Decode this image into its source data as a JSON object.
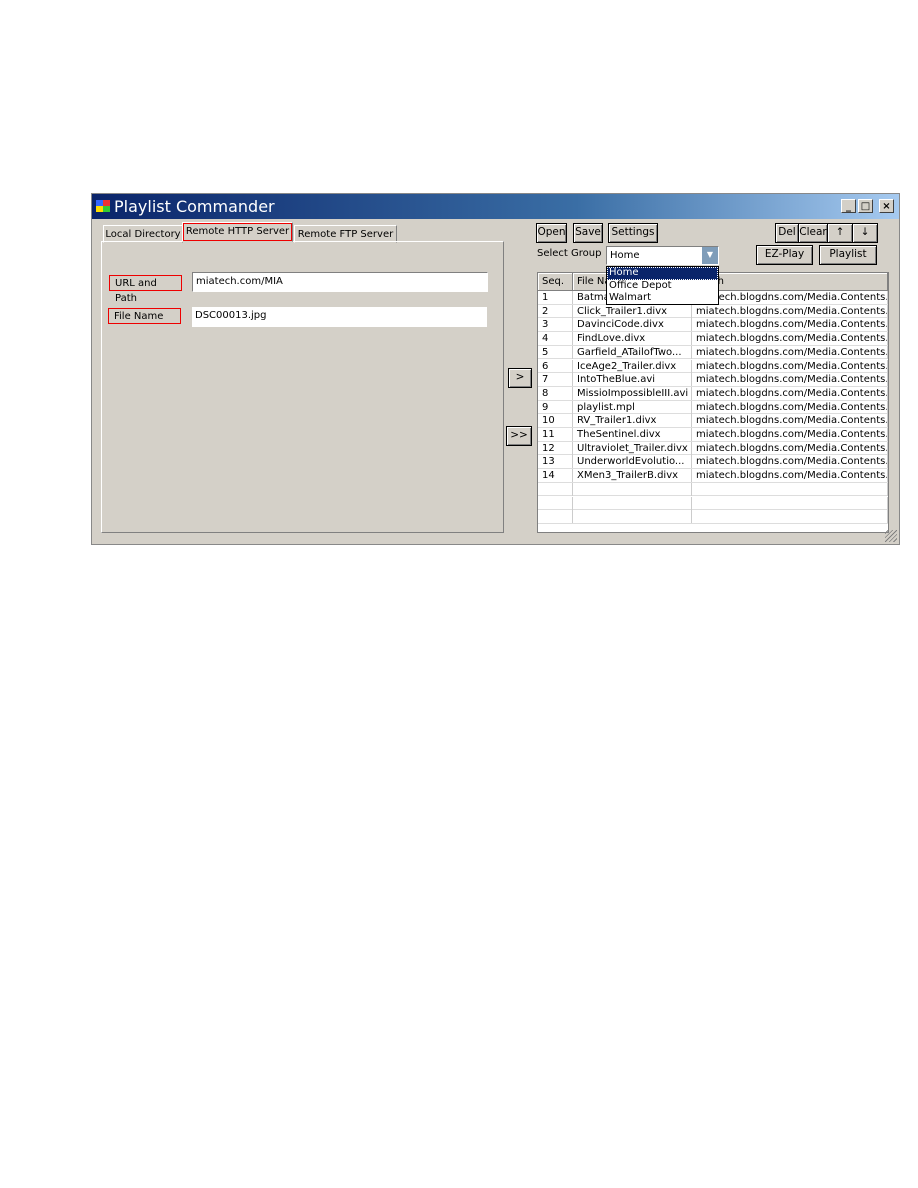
{
  "window": {
    "title": "Playlist Commander",
    "minimize": "_",
    "maximize": "□",
    "close": "×"
  },
  "tabs": [
    {
      "label": "Local Directory"
    },
    {
      "label": "Remote HTTP Server",
      "active": true
    },
    {
      "label": "Remote FTP Server"
    }
  ],
  "form": {
    "url_label": "URL and Path",
    "url_value": "miatech.com/MIA",
    "file_label": "File Name",
    "file_value": "DSC00013.jpg"
  },
  "transfer": {
    "add_one": ">",
    "add_all": ">>"
  },
  "toolbar": {
    "open": "Open",
    "save": "Save",
    "settings": "Settings",
    "del": "Del",
    "clear": "Clear",
    "up": "↑",
    "down": "↓",
    "ez_play": "EZ-Play",
    "playlist": "Playlist"
  },
  "group": {
    "label": "Select Group",
    "selected": "Home",
    "options": [
      "Home",
      "Office Depot",
      "Walmart"
    ]
  },
  "table": {
    "columns": [
      "Seq.",
      "File Name",
      "Path"
    ],
    "rows": [
      [
        "1",
        "Batma",
        "miatech.blogdns.com/Media.Contents..."
      ],
      [
        "2",
        "Click_Trailer1.divx",
        "miatech.blogdns.com/Media.Contents..."
      ],
      [
        "3",
        "DavinciCode.divx",
        "miatech.blogdns.com/Media.Contents..."
      ],
      [
        "4",
        "FindLove.divx",
        "miatech.blogdns.com/Media.Contents..."
      ],
      [
        "5",
        "Garfield_ATailofTwo...",
        "miatech.blogdns.com/Media.Contents..."
      ],
      [
        "6",
        "IceAge2_Trailer.divx",
        "miatech.blogdns.com/Media.Contents..."
      ],
      [
        "7",
        "IntoTheBlue.avi",
        "miatech.blogdns.com/Media.Contents..."
      ],
      [
        "8",
        "MissioImpossibleIII.avi",
        "miatech.blogdns.com/Media.Contents..."
      ],
      [
        "9",
        "playlist.mpl",
        "miatech.blogdns.com/Media.Contents..."
      ],
      [
        "10",
        "RV_Trailer1.divx",
        "miatech.blogdns.com/Media.Contents..."
      ],
      [
        "11",
        "TheSentinel.divx",
        "miatech.blogdns.com/Media.Contents..."
      ],
      [
        "12",
        "Ultraviolet_Trailer.divx",
        "miatech.blogdns.com/Media.Contents..."
      ],
      [
        "13",
        "UnderworldEvolutio...",
        "miatech.blogdns.com/Media.Contents..."
      ],
      [
        "14",
        "XMen3_TrailerB.divx",
        "miatech.blogdns.com/Media.Contents..."
      ]
    ]
  },
  "colors": {
    "titlebar": "#0a246a",
    "highlight": "#e00000",
    "selection": "#0a246a"
  }
}
